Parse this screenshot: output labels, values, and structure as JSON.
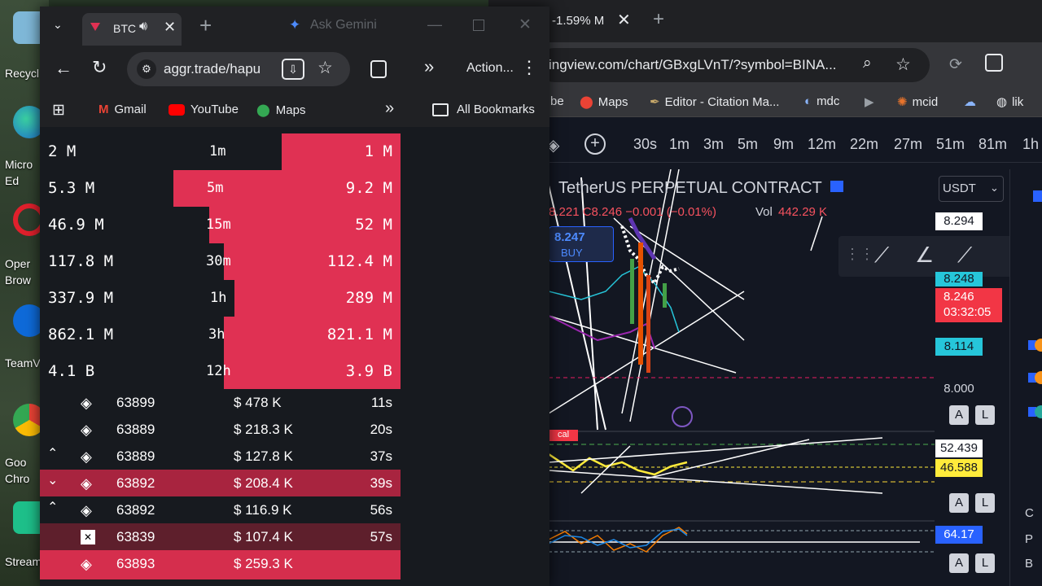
{
  "desktop": {
    "icons": [
      {
        "label": "Recycl"
      },
      {
        "label": "Micro",
        "label2": "Ed"
      },
      {
        "label": "Oper",
        "label2": "Brow"
      },
      {
        "label": "TeamV"
      },
      {
        "label": "Goo",
        "label2": "Chro"
      },
      {
        "label": "Stream"
      }
    ]
  },
  "bg_browser": {
    "tab_title": "-1.59% M",
    "url": "ingview.com/chart/GBxgLVnT/?symbol=BINA...",
    "bookmarks": [
      "be",
      "Maps",
      "Editor - Citation Ma...",
      "mdc",
      "mcid",
      "lik"
    ],
    "intervals": [
      "30s",
      "1m",
      "3m",
      "5m",
      "9m",
      "12m",
      "22m",
      "27m",
      "51m",
      "81m",
      "1h"
    ],
    "currency_select": "USDT",
    "symbol_title": "TetherUS PERPETUAL CONTRACT",
    "ohlc_text": "8.221 C8.246 −0.001 (−0.01%)",
    "vol_label": "Vol",
    "vol_value": "442.29 K",
    "buy_price": "8.247",
    "buy_label": "BUY",
    "price_labels": {
      "p1": "8.294",
      "p2": "8.248",
      "p3": "8.246",
      "countdown": "03:32:05",
      "p4": "8.114",
      "p5": "8.000",
      "i1a": "52.439",
      "i1b": "46.588",
      "i2": "64.17"
    },
    "ind_label": "cal",
    "al_a": "A",
    "al_l": "L",
    "right_letters": [
      "C",
      "P",
      "B"
    ]
  },
  "fg_browser": {
    "tab_title": "BTC",
    "ask_gemini": "Ask Gemini",
    "url": "aggr.trade/hapu",
    "actions_label": "Action...",
    "bookmarks": {
      "gmail": "Gmail",
      "youtube": "YouTube",
      "maps": "Maps",
      "all": "All Bookmarks"
    }
  },
  "aggr": {
    "stats": [
      {
        "left": "2 M",
        "tf": "1m",
        "right": "1 M",
        "buy_frac": 0.33
      },
      {
        "left": "5.3 M",
        "tf": "5m",
        "right": "9.2 M",
        "buy_frac": 0.63
      },
      {
        "left": "46.9 M",
        "tf": "15m",
        "right": "52 M",
        "buy_frac": 0.53
      },
      {
        "left": "117.8 M",
        "tf": "30m",
        "right": "112.4 M",
        "buy_frac": 0.49
      },
      {
        "left": "337.9 M",
        "tf": "1h",
        "right": "289 M",
        "buy_frac": 0.46
      },
      {
        "left": "862.1 M",
        "tf": "3h",
        "right": "821.1 M",
        "buy_frac": 0.49
      },
      {
        "left": "4.1 B",
        "tf": "12h",
        "right": "3.9 B",
        "buy_frac": 0.49
      }
    ],
    "trades": [
      {
        "arrow": "",
        "exchange": "binance",
        "price": "63899",
        "amount": "$ 478 K",
        "time": "11s",
        "style": "dark"
      },
      {
        "arrow": "",
        "exchange": "binance",
        "price": "63889",
        "amount": "$ 218.3 K",
        "time": "20s",
        "style": "dark"
      },
      {
        "arrow": "up",
        "exchange": "binance",
        "price": "63889",
        "amount": "$ 127.8 K",
        "time": "37s",
        "style": "dark"
      },
      {
        "arrow": "down",
        "exchange": "binance",
        "price": "63892",
        "amount": "$ 208.4 K",
        "time": "39s",
        "style": "red"
      },
      {
        "arrow": "up",
        "exchange": "binance",
        "price": "63892",
        "amount": "$ 116.9 K",
        "time": "56s",
        "style": "dark"
      },
      {
        "arrow": "",
        "exchange": "okx",
        "price": "63839",
        "amount": "$ 107.4 K",
        "time": "57s",
        "style": "maroon"
      },
      {
        "arrow": "",
        "exchange": "binance",
        "price": "63893",
        "amount": "$ 259.3 K",
        "time": "",
        "style": "bright"
      }
    ]
  },
  "colors": {
    "buy_red": "#e03153",
    "dark_row": "#171a1f",
    "red_row": "#a8243f",
    "maroon_row": "#5e1f2c",
    "bright_row": "#d52e4d"
  }
}
